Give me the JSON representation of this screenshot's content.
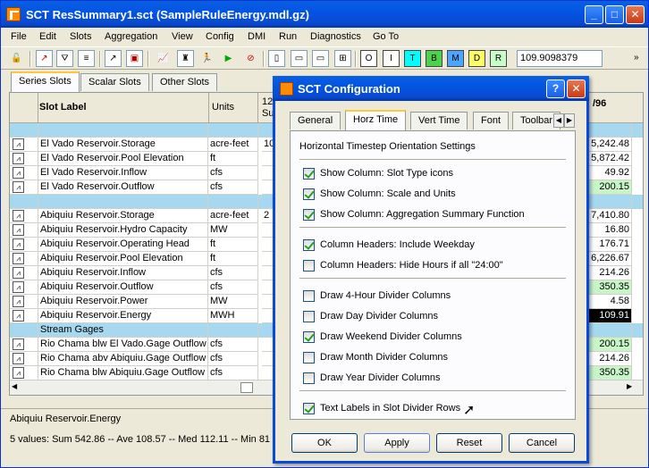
{
  "window": {
    "title": "SCT ResSummary1.sct (SampleRuleEnergy.mdl.gz)"
  },
  "menu": [
    "File",
    "Edit",
    "Slots",
    "Aggregation",
    "View",
    "Config",
    "DMI",
    "Run",
    "Diagnostics",
    "Go To"
  ],
  "toolbar": {
    "value": "109.9098379",
    "letters": [
      "O",
      "I",
      "T",
      "B",
      "M",
      "D",
      "R"
    ]
  },
  "tabs": [
    "Series Slots",
    "Scalar Slots",
    "Other Slots"
  ],
  "grid": {
    "col_slot_label": "Slot Label",
    "col_units": "Units",
    "col_date_partial": "12,",
    "col_date_partial2": "Su",
    "col_right_header": "/96",
    "rows": [
      {
        "label": "",
        "units": "",
        "mid": "",
        "value": "",
        "type": "divider"
      },
      {
        "label": "El Vado Reservoir.Storage",
        "units": "acre-feet",
        "mid": "10",
        "value": "5,242.48",
        "type": "data"
      },
      {
        "label": "El Vado Reservoir.Pool Elevation",
        "units": "ft",
        "mid": "",
        "value": "5,872.42",
        "type": "data"
      },
      {
        "label": "El Vado Reservoir.Inflow",
        "units": "cfs",
        "mid": "",
        "value": "49.92",
        "type": "data"
      },
      {
        "label": "El Vado Reservoir.Outflow",
        "units": "cfs",
        "mid": "",
        "value": "200.15",
        "type": "data-green"
      },
      {
        "label": "",
        "units": "",
        "mid": "",
        "value": "",
        "type": "divider"
      },
      {
        "label": "Abiquiu Reservoir.Storage",
        "units": "acre-feet",
        "mid": "2",
        "value": "7,410.80",
        "type": "data"
      },
      {
        "label": "Abiquiu Reservoir.Hydro Capacity",
        "units": "MW",
        "mid": "",
        "value": "16.80",
        "type": "data"
      },
      {
        "label": "Abiquiu Reservoir.Operating Head",
        "units": "ft",
        "mid": "",
        "value": "176.71",
        "type": "data"
      },
      {
        "label": "Abiquiu Reservoir.Pool Elevation",
        "units": "ft",
        "mid": "",
        "value": "6,226.67",
        "type": "data"
      },
      {
        "label": "Abiquiu Reservoir.Inflow",
        "units": "cfs",
        "mid": "",
        "value": "214.26",
        "type": "data"
      },
      {
        "label": "Abiquiu Reservoir.Outflow",
        "units": "cfs",
        "mid": "",
        "value": "350.35",
        "type": "data-green"
      },
      {
        "label": "Abiquiu Reservoir.Power",
        "units": "MW",
        "mid": "",
        "value": "4.58",
        "type": "data"
      },
      {
        "label": "Abiquiu Reservoir.Energy",
        "units": "MWH",
        "mid": "",
        "value": "109.91",
        "type": "data-selected"
      },
      {
        "label": "Stream Gages",
        "units": "",
        "mid": "",
        "value": "",
        "type": "divider-labeled"
      },
      {
        "label": "Rio Chama blw El Vado.Gage Outflow",
        "units": "cfs",
        "mid": "",
        "value": "200.15",
        "type": "data-green"
      },
      {
        "label": "Rio Chama abv Abiquiu.Gage Outflow",
        "units": "cfs",
        "mid": "",
        "value": "214.26",
        "type": "data"
      },
      {
        "label": "Rio Chama blw Abiquiu.Gage Outflow",
        "units": "cfs",
        "mid": "",
        "value": "350.35",
        "type": "data-green"
      }
    ]
  },
  "status": {
    "slot": "Abiquiu Reservoir.Energy",
    "summary": "5 values:  Sum 542.86 -- Ave 108.57 -- Med 112.11 -- Min 81"
  },
  "dialog": {
    "title": "SCT Configuration",
    "tabs": [
      "General",
      "Horz Time",
      "Vert Time",
      "Font",
      "Toolbar"
    ],
    "heading": "Horizontal Timestep Orientation Settings",
    "groups": [
      [
        {
          "label": "Show Column: Slot Type icons",
          "checked": true
        },
        {
          "label": "Show Column: Scale and Units",
          "checked": true
        },
        {
          "label": "Show Column: Aggregation Summary Function",
          "checked": true
        }
      ],
      [
        {
          "label": "Column Headers: Include Weekday",
          "checked": true
        },
        {
          "label": "Column Headers: Hide Hours if all \"24:00\"",
          "checked": false
        }
      ],
      [
        {
          "label": "Draw 4-Hour Divider Columns",
          "checked": false
        },
        {
          "label": "Draw Day Divider Columns",
          "checked": false
        },
        {
          "label": "Draw Weekend Divider Columns",
          "checked": true
        },
        {
          "label": "Draw Month Divider Columns",
          "checked": false
        },
        {
          "label": "Draw Year Divider Columns",
          "checked": false
        }
      ],
      [
        {
          "label": "Text Labels in Slot Divider Rows",
          "checked": true
        }
      ]
    ],
    "buttons": {
      "ok": "OK",
      "apply": "Apply",
      "reset": "Reset",
      "cancel": "Cancel"
    }
  }
}
